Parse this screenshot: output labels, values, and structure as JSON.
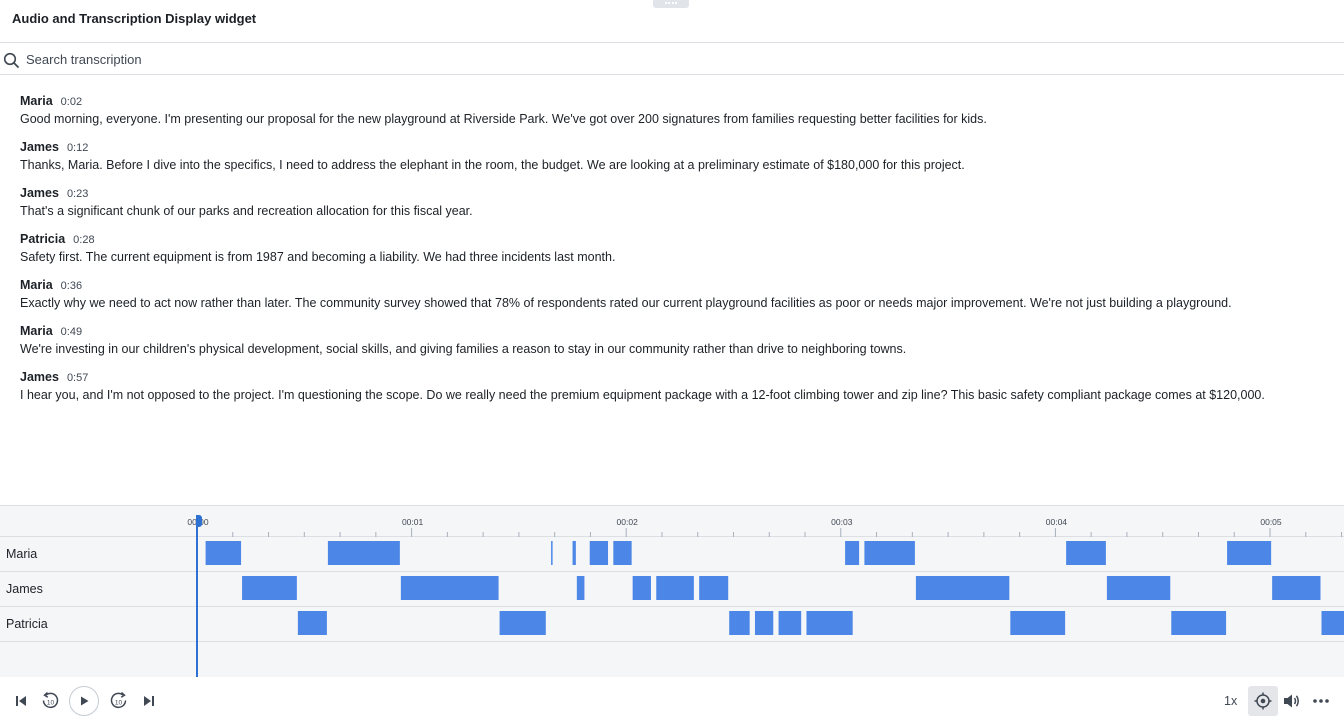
{
  "header": {
    "title": "Audio and Transcription Display widget"
  },
  "search": {
    "placeholder": "Search transcription",
    "value": ""
  },
  "transcript": [
    {
      "speaker": "Maria",
      "time": "0:02",
      "text": "Good morning, everyone. I'm presenting our proposal for the new playground at Riverside Park. We've got over 200 signatures from families requesting better facilities for kids."
    },
    {
      "speaker": "James",
      "time": "0:12",
      "text": "Thanks, Maria. Before I dive into the specifics, I need to address the elephant in the room, the budget. We are looking at a preliminary estimate of $180,000 for this project."
    },
    {
      "speaker": "James",
      "time": "0:23",
      "text": "That's a significant chunk of our parks and recreation allocation for this fiscal year."
    },
    {
      "speaker": "Patricia",
      "time": "0:28",
      "text": "Safety first. The current equipment is from 1987 and becoming a liability. We had three incidents last month."
    },
    {
      "speaker": "Maria",
      "time": "0:36",
      "text": "Exactly why we need to act now rather than later. The community survey showed that 78% of respondents rated our current playground facilities as poor or needs major improvement. We're not just building a playground."
    },
    {
      "speaker": "Maria",
      "time": "0:49",
      "text": "We're investing in our children's physical development, social skills, and giving families a reason to stay in our community rather than drive to neighboring towns."
    },
    {
      "speaker": "James",
      "time": "0:57",
      "text": "I hear you, and I'm not opposed to the project. I'm questioning the scope. Do we really need the premium equipment package with a 12-foot climbing tower and zip line? This basic safety compliant package comes at $120,000."
    }
  ],
  "timeline": {
    "tick_labels": [
      "00:00",
      "00:01",
      "00:02",
      "00:03",
      "00:04",
      "00:05"
    ],
    "playhead_seconds": 0,
    "tracks": [
      {
        "name": "Maria",
        "segments": [
          [
            0.04,
            0.21
          ],
          [
            0.61,
            0.95
          ],
          [
            1.65,
            1.66
          ],
          [
            1.75,
            1.77
          ],
          [
            1.83,
            1.92
          ],
          [
            1.94,
            2.03
          ],
          [
            3.02,
            3.09
          ],
          [
            3.11,
            3.35
          ],
          [
            4.05,
            4.24
          ],
          [
            4.8,
            5.01
          ]
        ]
      },
      {
        "name": "James",
        "segments": [
          [
            0.21,
            0.47
          ],
          [
            0.95,
            1.41
          ],
          [
            1.77,
            1.81
          ],
          [
            2.03,
            2.12
          ],
          [
            2.14,
            2.32
          ],
          [
            2.34,
            2.48
          ],
          [
            3.35,
            3.79
          ],
          [
            4.24,
            4.54
          ],
          [
            5.01,
            5.24
          ]
        ]
      },
      {
        "name": "Patricia",
        "segments": [
          [
            0.47,
            0.61
          ],
          [
            1.41,
            1.63
          ],
          [
            2.48,
            2.58
          ],
          [
            2.6,
            2.69
          ],
          [
            2.71,
            2.82
          ],
          [
            2.84,
            3.06
          ],
          [
            3.79,
            4.05
          ],
          [
            4.54,
            4.8
          ],
          [
            5.24,
            5.4
          ]
        ]
      }
    ]
  },
  "controls": {
    "speed": "1x",
    "skip_back_seconds": "10",
    "skip_forward_seconds": "10",
    "icons": [
      "skip-to-start-icon",
      "rewind-10-icon",
      "play-icon",
      "forward-10-icon",
      "skip-to-end-icon",
      "locate-playhead-icon",
      "volume-icon",
      "more-options-icon"
    ]
  },
  "colors": {
    "segment": "#4c87e8",
    "playhead": "#2d72d2",
    "accent": "#2d72d2"
  }
}
